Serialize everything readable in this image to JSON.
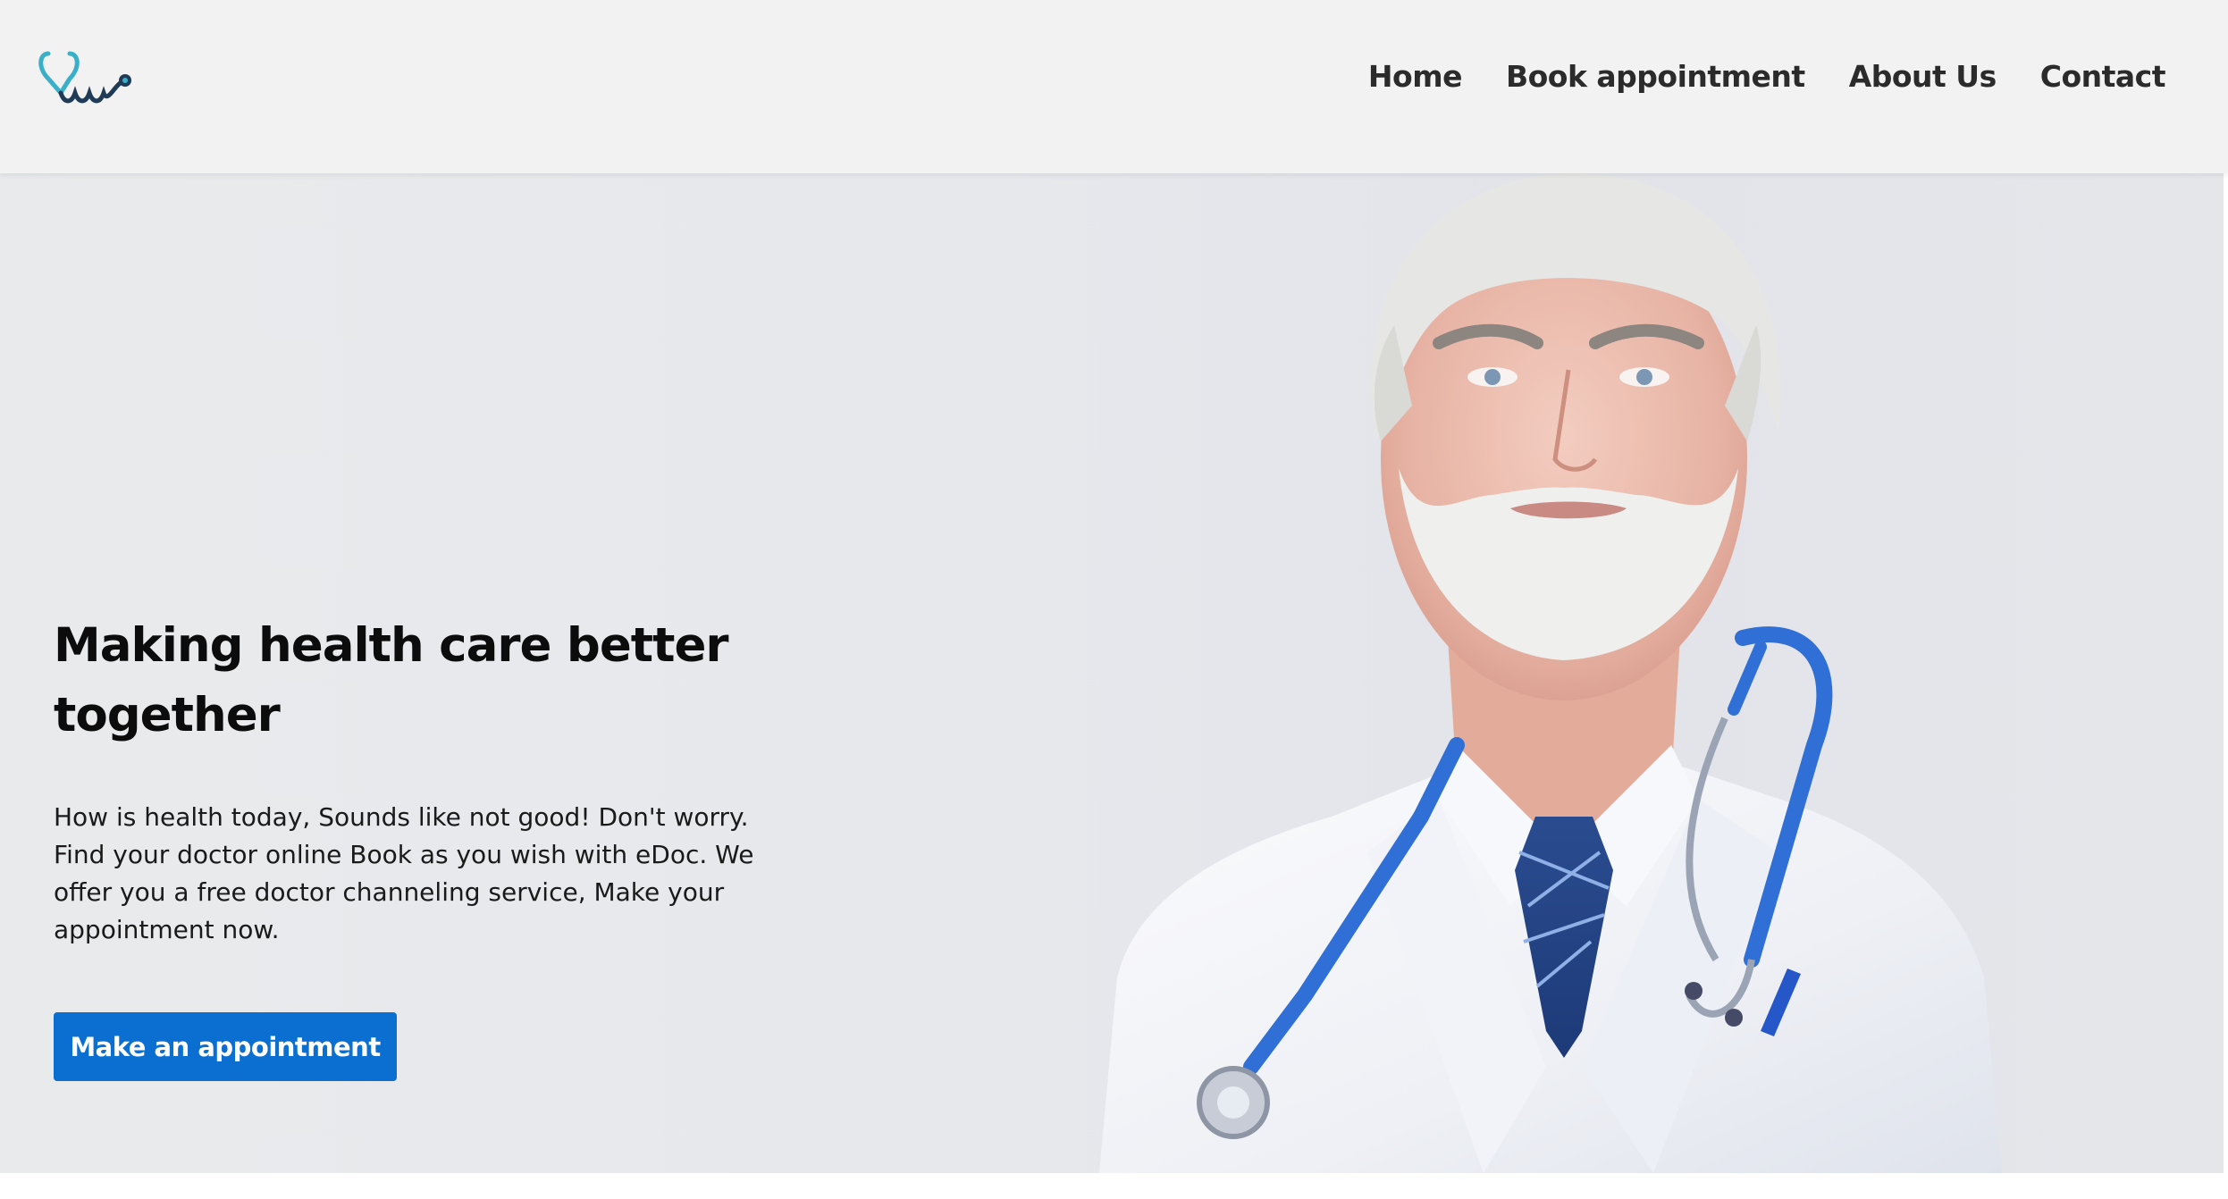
{
  "header": {
    "logo_icon": "stethoscope-heart-icon",
    "nav": [
      {
        "label": "Home"
      },
      {
        "label": "Book appointment"
      },
      {
        "label": "About Us"
      },
      {
        "label": "Contact"
      }
    ]
  },
  "hero": {
    "title_line1": "Making health care better",
    "title_line2": "together",
    "description": "How is health today, Sounds like not good! Don't worry. Find your doctor online Book as you wish with eDoc. We offer you a free doctor channeling service, Make your appointment now.",
    "cta_label": "Make an appointment",
    "image_icon": "doctor-photo"
  },
  "colors": {
    "accent": "#0a6fd1",
    "header_bg": "#f2f2f2",
    "logo_teal": "#3ab0c8",
    "logo_dark": "#1f3b57"
  }
}
